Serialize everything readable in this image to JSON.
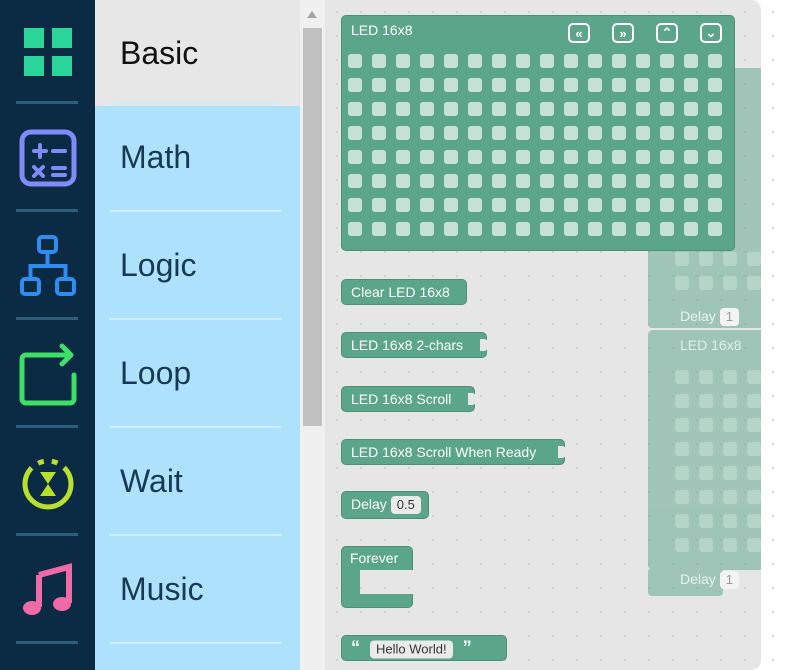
{
  "categories": [
    {
      "name": "Basic",
      "icon": "grid-icon",
      "active": true
    },
    {
      "name": "Math",
      "icon": "calculator-icon",
      "active": false
    },
    {
      "name": "Logic",
      "icon": "hierarchy-icon",
      "active": false
    },
    {
      "name": "Loop",
      "icon": "loop-arrow-icon",
      "active": false
    },
    {
      "name": "Wait",
      "icon": "hourglass-timer-icon",
      "active": false
    },
    {
      "name": "Music",
      "icon": "music-note-icon",
      "active": false
    }
  ],
  "blocks": {
    "led_matrix": {
      "label": "LED 16x8",
      "buttons": [
        "«",
        "»",
        "⌃",
        "⌄"
      ]
    },
    "clear": {
      "label": "Clear LED 16x8"
    },
    "two_chars": {
      "label": "LED 16x8 2-chars"
    },
    "scroll": {
      "label": "LED 16x8 Scroll"
    },
    "scroll_ready": {
      "label": "LED 16x8 Scroll When Ready"
    },
    "delay": {
      "label": "Delay",
      "value": "0.5"
    },
    "forever": {
      "label": "Forever"
    },
    "text": {
      "open_quote": "“",
      "value": "Hello World!",
      "close_quote": "”"
    }
  },
  "workspace": {
    "matrix1_label": "LED 16x8",
    "delay1": {
      "label": "Delay",
      "value": "1"
    },
    "delay2": {
      "label": "Delay",
      "value": "1"
    }
  },
  "colors": {
    "block": "#5ba58b",
    "rail": "#0b2a43",
    "menu": "#aee1fb",
    "led_on": "#e00000"
  }
}
